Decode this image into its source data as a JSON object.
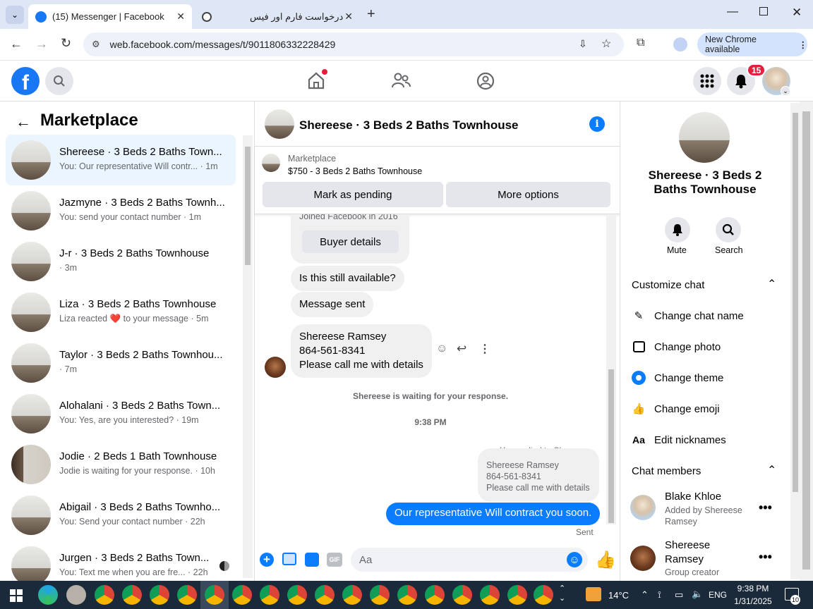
{
  "browser": {
    "tabs": [
      {
        "title": "(15) Messenger | Facebook"
      },
      {
        "title": "درخواست فارم اور فیس"
      }
    ],
    "url": "web.facebook.com/messages/t/9011806332228429",
    "update_button": "New Chrome available"
  },
  "fb_header": {
    "notification_count": "15"
  },
  "left_panel": {
    "title": "Marketplace",
    "conversations": [
      {
        "name": "Shereese · 3 Beds 2 Baths Town...",
        "preview": "You: Our representative Will contr... · 1m"
      },
      {
        "name": "Jazmyne · 3 Beds 2 Baths Townh...",
        "preview": "You: send your contact number · 1m"
      },
      {
        "name": "J-r · 3 Beds 2 Baths Townhouse",
        "preview": "· 3m"
      },
      {
        "name": "Liza · 3 Beds 2 Baths Townhouse",
        "preview": "Liza reacted ❤️ to your message · 5m"
      },
      {
        "name": "Taylor · 3 Beds 2 Baths Townhou...",
        "preview": "· 7m"
      },
      {
        "name": "Alohalani · 3 Beds 2 Baths Town...",
        "preview": "You: Yes, are you interested? · 19m"
      },
      {
        "name": "Jodie · 2 Beds 1 Bath Townhouse",
        "preview": "Jodie is waiting for your response. · 10h"
      },
      {
        "name": "Abigail · 3 Beds 2 Baths Townho...",
        "preview": "You: Send your contact number · 22h"
      },
      {
        "name": "Jurgen · 3 Beds 2 Baths Town...",
        "preview": "You: Text me when you are fre... · 22h"
      }
    ]
  },
  "chat": {
    "title": "Shereese · 3 Beds 2 Baths Townhouse",
    "listing_source": "Marketplace",
    "listing": "$750 - 3 Beds 2 Baths Townhouse",
    "mark_pending": "Mark as pending",
    "more_options": "More options",
    "joined": "Joined Facebook in 2016",
    "buyer_details": "Buyer details",
    "messages": {
      "m1": "Is this still available?",
      "m2": "Message sent",
      "m3_line1": "Shereese Ramsey",
      "m3_line2": "864-561-8341",
      "m3_line3": "Please call me with details"
    },
    "waiting": "Shereese is waiting for your response.",
    "time": "9:38 PM",
    "replied_to": "You replied to Shereese",
    "quote_line1": "Shereese Ramsey",
    "quote_line2": "864-561-8341",
    "quote_line3": "Please call me with details",
    "my_message": "Our representative Will contract you soon.",
    "status": "Sent",
    "composer_placeholder": "Aa"
  },
  "right_panel": {
    "title": "Shereese · 3 Beds 2 Baths Townhouse",
    "mute": "Mute",
    "search": "Search",
    "customize": "Customize chat",
    "change_name": "Change chat name",
    "change_photo": "Change photo",
    "change_theme": "Change theme",
    "change_emoji": "Change emoji",
    "edit_nicknames": "Edit nicknames",
    "members_header": "Chat members",
    "members": [
      {
        "name": "Blake Khloe",
        "sub": "Added by Shereese Ramsey"
      },
      {
        "name": "Shereese Ramsey",
        "sub": "Group creator"
      }
    ]
  },
  "taskbar": {
    "temperature": "14°C",
    "language": "ENG",
    "time": "9:38 PM",
    "date": "1/31/2025",
    "notif_count": "10"
  }
}
